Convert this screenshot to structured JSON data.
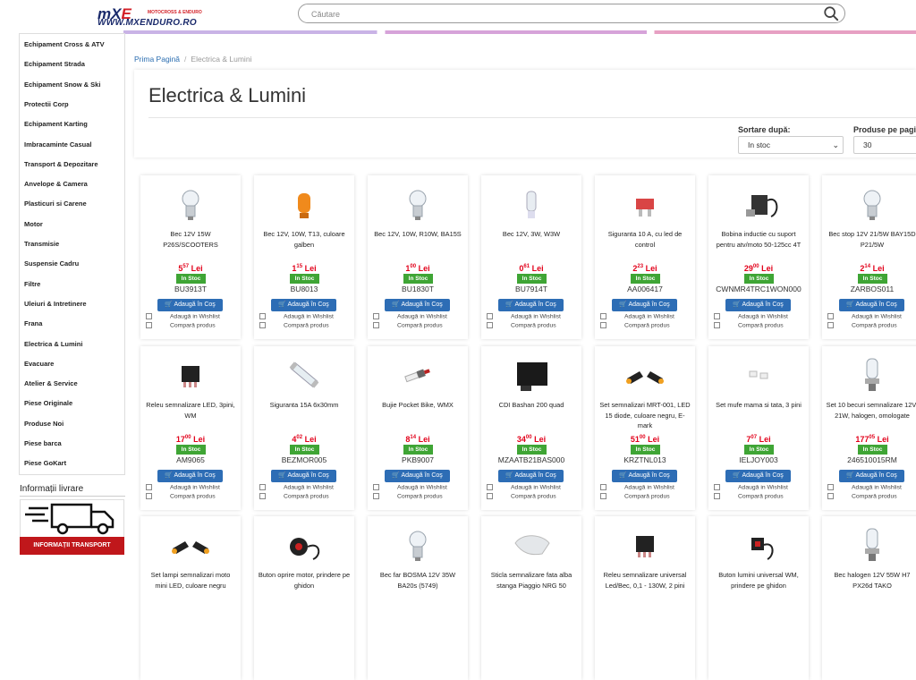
{
  "logo": {
    "brand_mx": "mX",
    "brand_rest": "E",
    "tagline": "MOTOCROSS & ENDURO",
    "url": "WWW.MXENDURO.RO"
  },
  "search": {
    "placeholder": "Căutare"
  },
  "sidebar": {
    "items": [
      {
        "label": "Echipament Cross & ATV"
      },
      {
        "label": "Echipament Strada"
      },
      {
        "label": "Echipament Snow & Ski"
      },
      {
        "label": "Protectii Corp"
      },
      {
        "label": "Echipament Karting"
      },
      {
        "label": "Imbracaminte Casual"
      },
      {
        "label": "Transport & Depozitare"
      },
      {
        "label": "Anvelope & Camera"
      },
      {
        "label": "Plasticuri si Carene"
      },
      {
        "label": "Motor"
      },
      {
        "label": "Transmisie"
      },
      {
        "label": "Suspensie Cadru"
      },
      {
        "label": "Filtre"
      },
      {
        "label": "Uleiuri & Intretinere"
      },
      {
        "label": "Frana"
      },
      {
        "label": "Electrica & Lumini"
      },
      {
        "label": "Evacuare"
      },
      {
        "label": "Atelier & Service"
      },
      {
        "label": "Piese Originale"
      },
      {
        "label": "Produse Noi"
      },
      {
        "label": "Piese barca"
      },
      {
        "label": "Piese GoKart"
      }
    ]
  },
  "delivery": {
    "title": "Informații livrare",
    "banner_label": "INFORMAȚII TRANSPORT"
  },
  "breadcrumb": {
    "home": "Prima Pagină",
    "separator": "/",
    "current": "Electrica & Lumini"
  },
  "page": {
    "title": "Electrica & Lumini"
  },
  "controls": {
    "sort_label": "Sortare după:",
    "sort_value": "In stoc",
    "per_page_label": "Produse pe pagi",
    "per_page_value": "30"
  },
  "card_labels": {
    "in_stock": "In Stoc",
    "add_to_cart": "Adaugă în Coş",
    "wishlist": "Adaugă in Wishlist",
    "compare": "Compară produs",
    "currency": "Lei"
  },
  "products": [
    {
      "name": "Bec 12V 15W P26S/SCOOTERS",
      "price_int": "5",
      "price_dec": "57",
      "code": "BU3913T",
      "icon": "bulb-icon"
    },
    {
      "name": "Bec 12V, 10W, T13, culoare galben",
      "price_int": "1",
      "price_dec": "15",
      "code": "BU8013",
      "icon": "amber-bulb-icon"
    },
    {
      "name": "Bec 12V, 10W, R10W, BA15S",
      "price_int": "1",
      "price_dec": "00",
      "code": "BU1830T",
      "icon": "bulb-icon"
    },
    {
      "name": "Bec 12V, 3W, W3W",
      "price_int": "0",
      "price_dec": "61",
      "code": "BU7914T",
      "icon": "wedge-bulb-icon"
    },
    {
      "name": "Siguranta 10 A, cu led de control",
      "price_int": "2",
      "price_dec": "23",
      "code": "AA006417",
      "icon": "fuse-icon"
    },
    {
      "name": "Bobina inductie cu suport pentru atv/moto 50-125cc 4T",
      "price_int": "29",
      "price_dec": "00",
      "code": "CWNMR4TRC1WON000",
      "icon": "coil-icon"
    },
    {
      "name": "Bec stop 12V 21/5W BAY15D P21/5W",
      "price_int": "2",
      "price_dec": "14",
      "code": "ZARBOS011",
      "icon": "bulb-icon"
    },
    {
      "name": "Releu semnalizare LED, 3pini, WM",
      "price_int": "17",
      "price_dec": "00",
      "code": "AM9065",
      "icon": "relay-icon"
    },
    {
      "name": "Siguranta 15A 6x30mm",
      "price_int": "4",
      "price_dec": "02",
      "code": "BEZMOR005",
      "icon": "glass-fuse-icon"
    },
    {
      "name": "Bujie Pocket Bike, WMX",
      "price_int": "8",
      "price_dec": "14",
      "code": "PKB9007",
      "icon": "spark-plug-icon"
    },
    {
      "name": "CDI Bashan 200 quad",
      "price_int": "34",
      "price_dec": "00",
      "code": "MZAATB21BAS000",
      "icon": "cdi-module-icon"
    },
    {
      "name": "Set semnalizari MRT-001, LED 15 diode, culoare negru, E-mark",
      "price_int": "51",
      "price_dec": "00",
      "code": "KRZTNL013",
      "icon": "turn-signal-icon"
    },
    {
      "name": "Set mufe mama si tata, 3 pini",
      "price_int": "7",
      "price_dec": "07",
      "code": "IELJOY003",
      "icon": "connector-icon"
    },
    {
      "name": "Set 10 becuri semnalizare 12V-21W, halogen, omologate",
      "price_int": "177",
      "price_dec": "05",
      "code": "246510015RM",
      "icon": "halogen-bulb-icon"
    },
    {
      "name": "Set lampi semnalizari moto mini LED, culoare negru",
      "icon": "turn-signal-icon"
    },
    {
      "name": "Buton oprire motor, prindere pe ghidon",
      "icon": "kill-switch-icon"
    },
    {
      "name": "Bec far BOSMA 12V 35W BA20s (5749)",
      "icon": "bulb-icon"
    },
    {
      "name": "Sticla semnalizare fata alba stanga Piaggio NRG 50",
      "icon": "lens-icon"
    },
    {
      "name": "Releu semnalizare universal Led/Bec, 0,1 - 130W, 2 pini",
      "icon": "relay-icon"
    },
    {
      "name": "Buton lumini universal WM, prindere pe ghidon",
      "icon": "light-switch-icon"
    },
    {
      "name": "Bec halogen 12V 55W H7 PX26d TAKO",
      "icon": "halogen-bulb-icon"
    }
  ]
}
